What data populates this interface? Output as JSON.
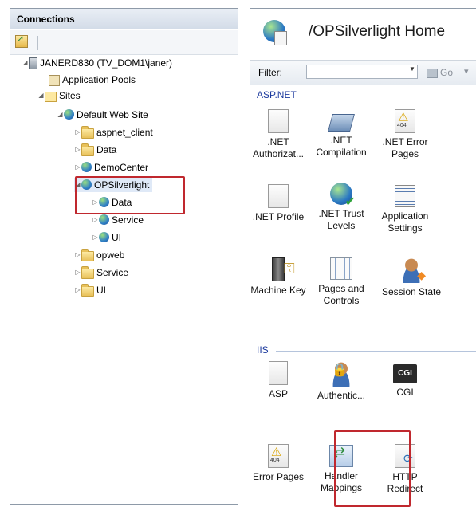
{
  "connections": {
    "title": "Connections",
    "tree": [
      {
        "label": "JANERD830 (TV_DOM1\\janer)",
        "icon": "server-icon"
      },
      {
        "label": "Application Pools",
        "icon": "app-pools-icon"
      },
      {
        "label": "Sites",
        "icon": "sites-folder-icon"
      },
      {
        "label": "Default Web Site",
        "icon": "globe-icon"
      },
      {
        "label": "aspnet_client",
        "icon": "folder-icon"
      },
      {
        "label": "Data",
        "icon": "folder-icon"
      },
      {
        "label": "DemoCenter",
        "icon": "globe-icon"
      },
      {
        "label": "OPSilverlight",
        "icon": "globe-icon"
      },
      {
        "label": "Data",
        "icon": "globe-icon"
      },
      {
        "label": "Service",
        "icon": "globe-icon"
      },
      {
        "label": "UI",
        "icon": "globe-icon"
      },
      {
        "label": "opweb",
        "icon": "folder-icon"
      },
      {
        "label": "Service",
        "icon": "folder-icon"
      },
      {
        "label": "UI",
        "icon": "folder-icon"
      }
    ]
  },
  "main": {
    "title": "/OPSilverlight Home",
    "filter_label": "Filter:",
    "filter_value": "",
    "go_label": "Go",
    "groups": {
      "aspnet": "ASP.NET",
      "iis": "IIS"
    },
    "features": {
      "net_authorization": ".NET\nAuthorizat...",
      "net_compilation": ".NET\nCompilation",
      "net_error_pages": ".NET Error\nPages",
      "net_profile": ".NET Profile",
      "net_trust_levels": ".NET Trust\nLevels",
      "application_settings": "Application\nSettings",
      "machine_key": "Machine Key",
      "pages_and_controls": "Pages and\nControls",
      "session_state": "Session State",
      "asp": "ASP",
      "authentication": "Authentic...",
      "cgi": "CGI",
      "cgi_icon_text": "CGI",
      "error_pages": "Error Pages",
      "handler_mappings": "Handler\nMappings",
      "http_redirect": "HTTP\nRedirect"
    }
  },
  "colors": {
    "highlight": "#c0282e",
    "group_label": "#1c3a9e"
  }
}
